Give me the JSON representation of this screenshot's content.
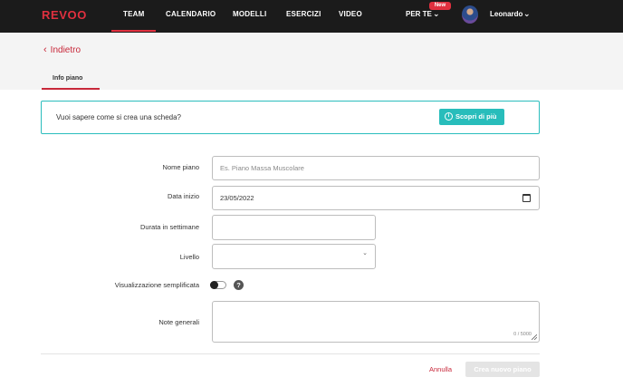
{
  "brand": {
    "logo_text": "REVOO",
    "accent_color": "#e0303f",
    "teal_color": "#28bdbb"
  },
  "nav": {
    "items": [
      {
        "label": "TEAM",
        "active": true
      },
      {
        "label": "CALENDARIO"
      },
      {
        "label": "MODELLI"
      },
      {
        "label": "ESERCIZI"
      },
      {
        "label": "VIDEO"
      }
    ],
    "for_you": {
      "label": "PER TE",
      "badge": "New",
      "icon": "chevron-down-icon"
    },
    "user": {
      "name": "Leonardo",
      "icon": "chevron-down-icon"
    }
  },
  "header": {
    "back_label": "Indietro",
    "tab_label": "Info piano"
  },
  "info_banner": {
    "text": "Vuoi sapere come si crea una scheda?",
    "button_label": "Scopri di più",
    "button_icon": "info-circle-icon"
  },
  "form": {
    "plan_name": {
      "label": "Nome piano",
      "value": "",
      "placeholder": "Es. Piano Massa Muscolare"
    },
    "start_date": {
      "label": "Data inizio",
      "value": "23/05/2022",
      "icon": "calendar-icon"
    },
    "duration": {
      "label": "Durata in settimane",
      "value": ""
    },
    "level": {
      "label": "Livello",
      "value": "",
      "icon": "chevron-down-icon"
    },
    "simplified_view": {
      "label": "Visualizzazione semplificata",
      "enabled": false,
      "help_icon": "question-icon"
    },
    "notes": {
      "label": "Note generali",
      "value": "",
      "counter": "0 / 5000"
    }
  },
  "actions": {
    "cancel_label": "Annulla",
    "create_label": "Crea nuovo piano"
  }
}
